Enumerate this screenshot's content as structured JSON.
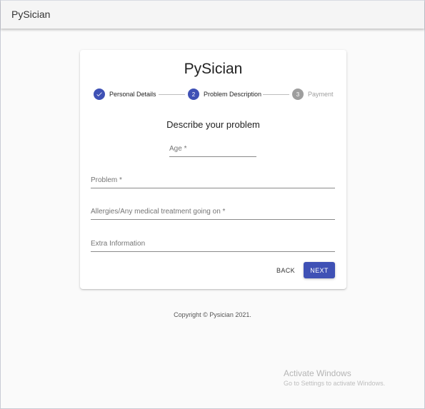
{
  "app": {
    "title": "PySician"
  },
  "card": {
    "title": "PySician",
    "section_title": "Describe your problem"
  },
  "stepper": {
    "steps": [
      {
        "label": "Personal Details",
        "number": "1",
        "state": "done",
        "icon": "check-icon"
      },
      {
        "label": "Problem Description",
        "number": "2",
        "state": "active"
      },
      {
        "label": "Payment",
        "number": "3",
        "state": "pending"
      }
    ]
  },
  "form": {
    "age_label": "Age *",
    "problem_label": "Problem *",
    "allergies_label": "Allergies/Any medical treatment going on  *",
    "extra_label": "Extra Information"
  },
  "actions": {
    "back_label": "BACK",
    "next_label": "NEXT"
  },
  "footer": {
    "copyright": "Copyright © Pysician 2021."
  },
  "watermark": {
    "title": "Activate Windows",
    "subtitle": "Go to Settings to activate Windows."
  },
  "colors": {
    "primary": "#3f51b5",
    "pending": "#9e9e9e",
    "background": "#fafafa"
  }
}
